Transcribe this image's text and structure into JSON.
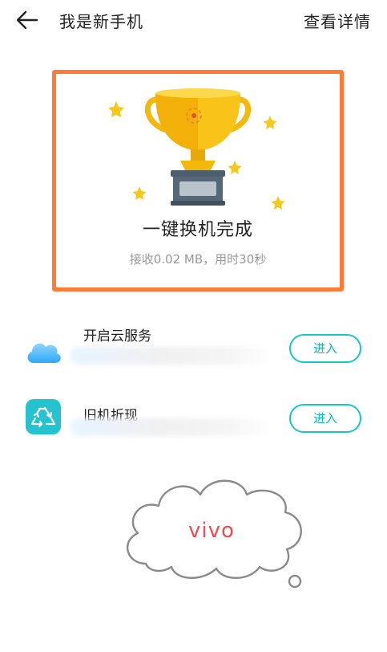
{
  "header": {
    "title": "我是新手机",
    "details_label": "查看详情",
    "back_icon": "arrow-left-icon"
  },
  "result": {
    "title": "一键换机完成",
    "subtitle": "接收0.02 MB，用时30秒",
    "icon": "trophy-icon"
  },
  "services": [
    {
      "title": "开启云服务",
      "icon": "cloud-icon",
      "button_label": "进入"
    },
    {
      "title": "旧机折现",
      "icon": "recycle-icon",
      "button_label": "进入"
    }
  ],
  "brand": {
    "text": "vivo"
  },
  "colors": {
    "accent_orange": "#ff7b36",
    "teal": "#19c6c6",
    "brand_red": "#f04a55",
    "trophy_gold": "#f2b80c"
  }
}
